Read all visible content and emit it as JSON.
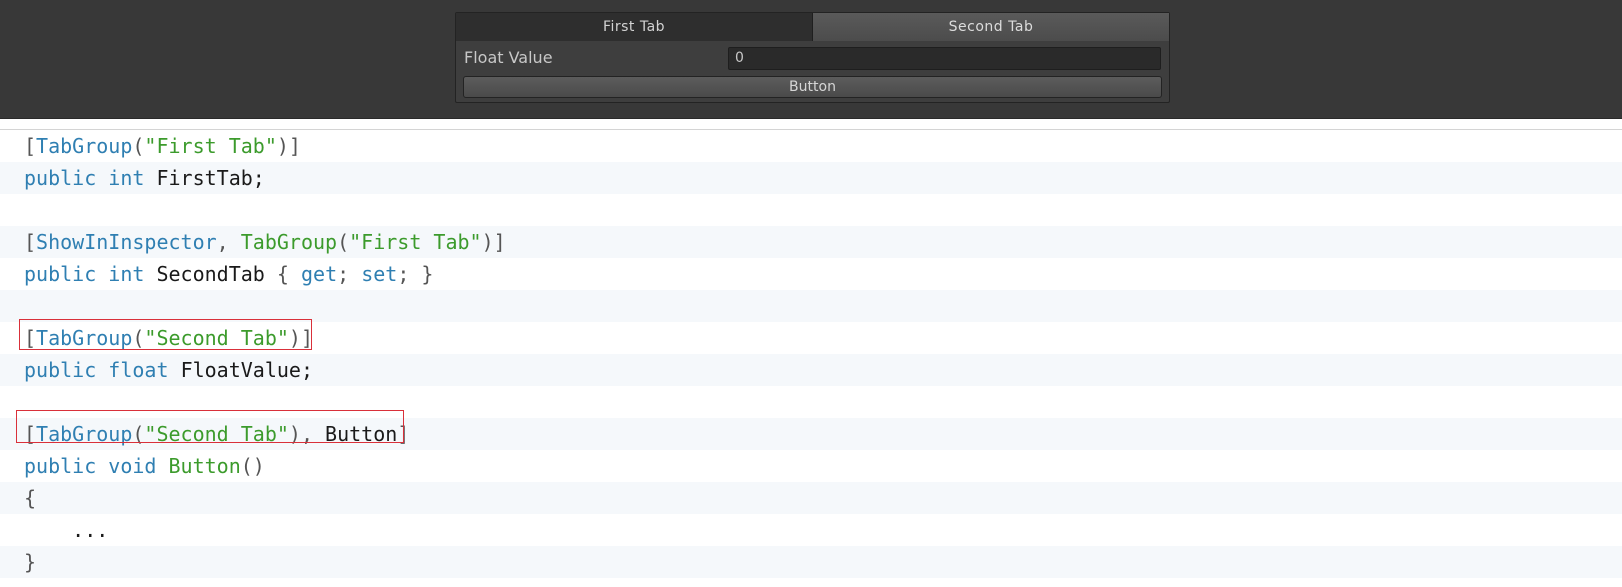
{
  "inspector": {
    "tabs": [
      "First Tab",
      "Second Tab"
    ],
    "active_tab": "Second Tab",
    "field_label": "Float Value",
    "field_value": "0",
    "button_label": "Button"
  },
  "code": {
    "l1": {
      "open": "[",
      "attr": "TabGroup",
      "p1": "(",
      "str": "\"First Tab\"",
      "close": ")]"
    },
    "l2": {
      "kw1": "public",
      "kw2": "int",
      "name": "FirstTab;"
    },
    "l4": {
      "open": "[",
      "attr1": "ShowInInspector",
      "comma": ", ",
      "attr2": "TabGroup",
      "p1": "(",
      "str": "\"First Tab\"",
      "close": ")]"
    },
    "l5": {
      "kw1": "public",
      "kw2": "int",
      "name": "SecondTab",
      "b1": "{",
      "get": "get",
      "semi1": ";",
      "set": "set",
      "semi2": ";",
      "b2": "}"
    },
    "l7": {
      "open": "[",
      "attr": "TabGroup",
      "p1": "(",
      "str": "\"Second Tab\"",
      "close": ")]"
    },
    "l8": {
      "kw1": "public",
      "kw2": "float",
      "name": "FloatValue;"
    },
    "l10": {
      "open": "[",
      "attr": "TabGroup",
      "p1": "(",
      "str": "\"Second Tab\"",
      "p2": "), ",
      "attr2": "Button",
      "close": "]"
    },
    "l11": {
      "kw1": "public",
      "kw2": "void",
      "name": "Button",
      "parens": "()"
    },
    "l12": {
      "brace": "{"
    },
    "l13": {
      "body": "..."
    },
    "l14": {
      "brace": "}"
    }
  }
}
